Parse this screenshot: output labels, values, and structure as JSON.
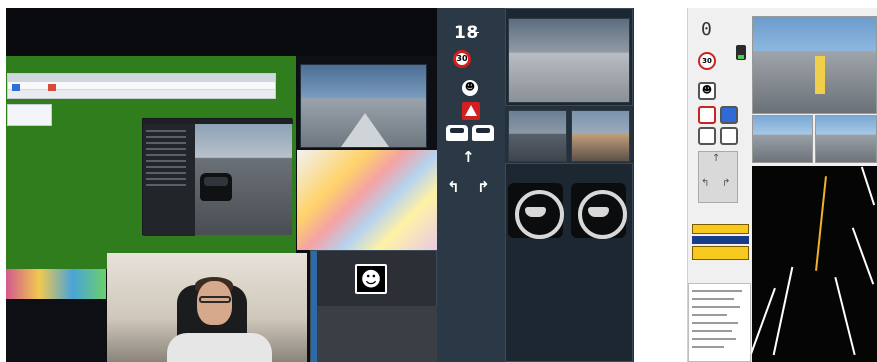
{
  "left_desktop": {
    "browser_text": "",
    "panel_text": "",
    "warning_icon_glyph": "☻"
  },
  "dashboard": {
    "speed": "18",
    "speed_limit_sign": "30",
    "icons": [
      "driver-face-icon",
      "warning-triangle-icon",
      "car-ahead-icon",
      "straight-arrow-icon",
      "turn-left-arrow-icon",
      "turn-right-arrow-icon"
    ],
    "arrows": [
      "↑",
      "↰",
      "↱"
    ]
  },
  "right_dashboard": {
    "speed": "0",
    "speed_limit_sign": "30",
    "colors": {
      "road_line": "#f0b02a",
      "tag": "#f7c81e",
      "tag_text_bg": "#1a3d8a"
    }
  }
}
